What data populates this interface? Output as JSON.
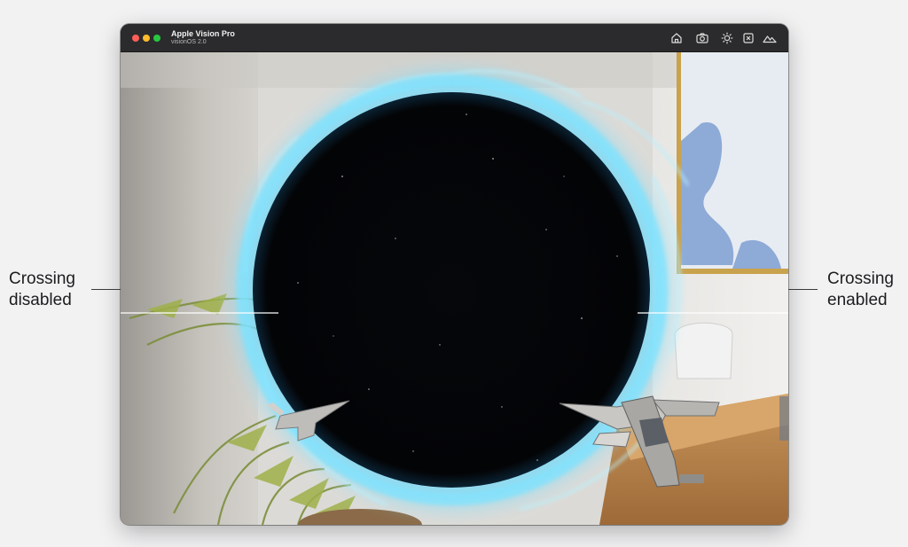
{
  "window": {
    "title": "Apple Vision Pro",
    "subtitle": "visionOS 2.0",
    "traffic_lights": [
      "close",
      "minimize",
      "zoom"
    ],
    "toolbar_icons": [
      "home-icon",
      "camera-icon",
      "brightness-icon",
      "close-box-icon",
      "landscape-icon"
    ]
  },
  "annotations": {
    "left": {
      "line1": "Crossing",
      "line2": "disabled"
    },
    "right": {
      "line1": "Crossing",
      "line2": "enabled"
    }
  },
  "colors": {
    "portal_glow": "#7fe3ff",
    "portal_interior": "#050608",
    "titlebar": "#2b2b2d",
    "page_background": "#f2f2f3"
  }
}
